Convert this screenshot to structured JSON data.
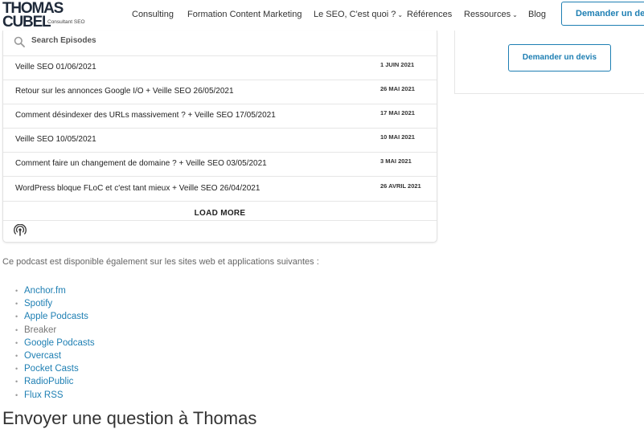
{
  "header": {
    "logo_line1": "THOMAS",
    "logo_line2": "CUBEL",
    "logo_sub": "Consultant SEO",
    "nav": [
      {
        "label": "Consulting",
        "dropdown": false
      },
      {
        "label": "Formation Content Marketing",
        "dropdown": false
      },
      {
        "label": "Le SEO, C'est quoi ?",
        "dropdown": true
      },
      {
        "label": "Références",
        "dropdown": false
      },
      {
        "label": "Ressources",
        "dropdown": true
      },
      {
        "label": "Blog",
        "dropdown": false
      }
    ],
    "cta": "Demander un devis"
  },
  "player": {
    "search_placeholder": "Search Episodes",
    "episodes": [
      {
        "title": "Veille SEO 01/06/2021",
        "date": "1 JUIN 2021"
      },
      {
        "title": "Retour sur les annonces Google I/O + Veille SEO 26/05/2021",
        "date": "26 MAI 2021"
      },
      {
        "title": "Comment désindexer des URLs massivement ? + Veille SEO 17/05/2021",
        "date": "17 MAI 2021"
      },
      {
        "title": "Veille SEO 10/05/2021",
        "date": "10 MAI 2021"
      },
      {
        "title": "Comment faire un changement de domaine ? + Veille SEO 03/05/2021",
        "date": "3 MAI 2021"
      },
      {
        "title": "WordPress bloque FLoC et c'est tant mieux + Veille SEO 26/04/2021",
        "date": "26 AVRIL 2021"
      }
    ],
    "load_more": "LOAD MORE"
  },
  "sidebar": {
    "cta": "Demander un devis"
  },
  "content": {
    "intro": "Ce podcast est disponible également sur les sites web et applications suivantes :",
    "platforms": [
      {
        "label": "Anchor.fm",
        "link": true
      },
      {
        "label": "Spotify",
        "link": true
      },
      {
        "label": "Apple Podcasts",
        "link": true
      },
      {
        "label": "Breaker",
        "link": false
      },
      {
        "label": "Google Podcasts",
        "link": true
      },
      {
        "label": "Overcast",
        "link": true
      },
      {
        "label": "Pocket Casts",
        "link": true
      },
      {
        "label": "RadioPublic",
        "link": true
      },
      {
        "label": "Flux RSS",
        "link": true
      }
    ],
    "heading": "Envoyer une question à Thomas"
  },
  "colors": {
    "accent": "#1e7fb3",
    "text": "#333333"
  }
}
